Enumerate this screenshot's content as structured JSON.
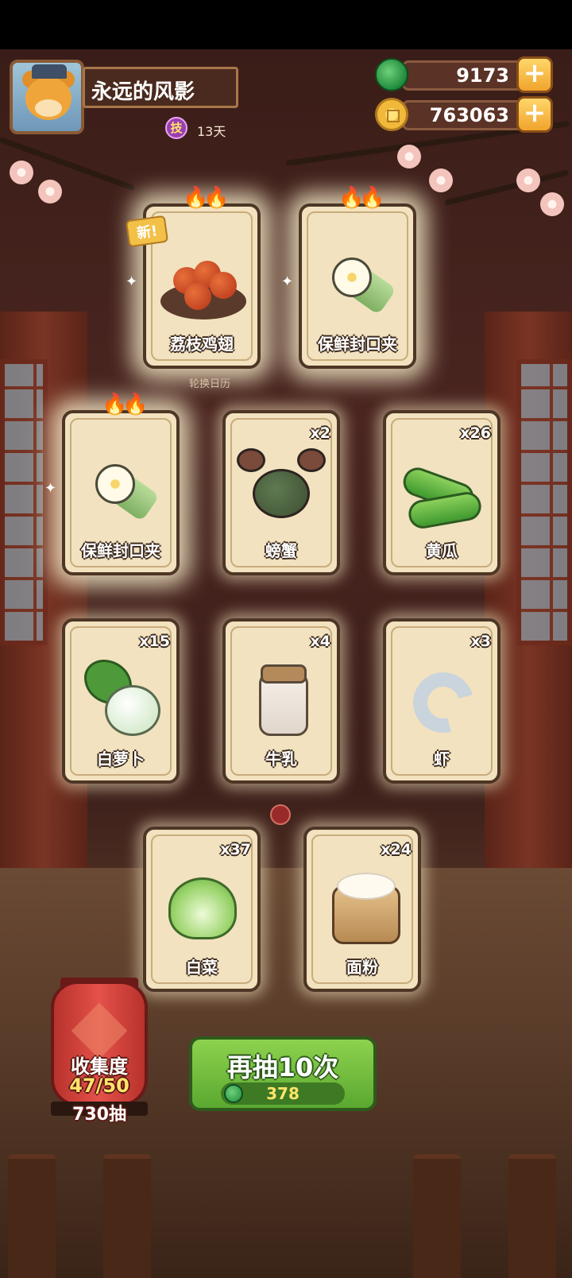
{
  "player": {
    "name": "永远的风影",
    "badge": "技",
    "days": "13天"
  },
  "resources": {
    "jade": "9173",
    "coins": "763063",
    "plus": "+"
  },
  "caption": "轮换日历",
  "cards": [
    {
      "name": "荔枝鸡翅",
      "count": "",
      "new_label": "新!",
      "flames": "🔥🔥"
    },
    {
      "name": "保鲜封口夹",
      "count": "",
      "flames": "🔥🔥"
    },
    {
      "name": "保鲜封口夹",
      "count": "",
      "flames": "🔥🔥"
    },
    {
      "name": "螃蟹",
      "count": "x2"
    },
    {
      "name": "黄瓜",
      "count": "x26"
    },
    {
      "name": "白萝卜",
      "count": "x15"
    },
    {
      "name": "牛乳",
      "count": "x4"
    },
    {
      "name": "虾",
      "count": "x3"
    },
    {
      "name": "白菜",
      "count": "x37"
    },
    {
      "name": "面粉",
      "count": "x24"
    }
  ],
  "collection": {
    "title": "收集度",
    "progress": "47/50",
    "draws": "730抽"
  },
  "draw_button": {
    "label": "再抽10次",
    "cost": "378"
  }
}
